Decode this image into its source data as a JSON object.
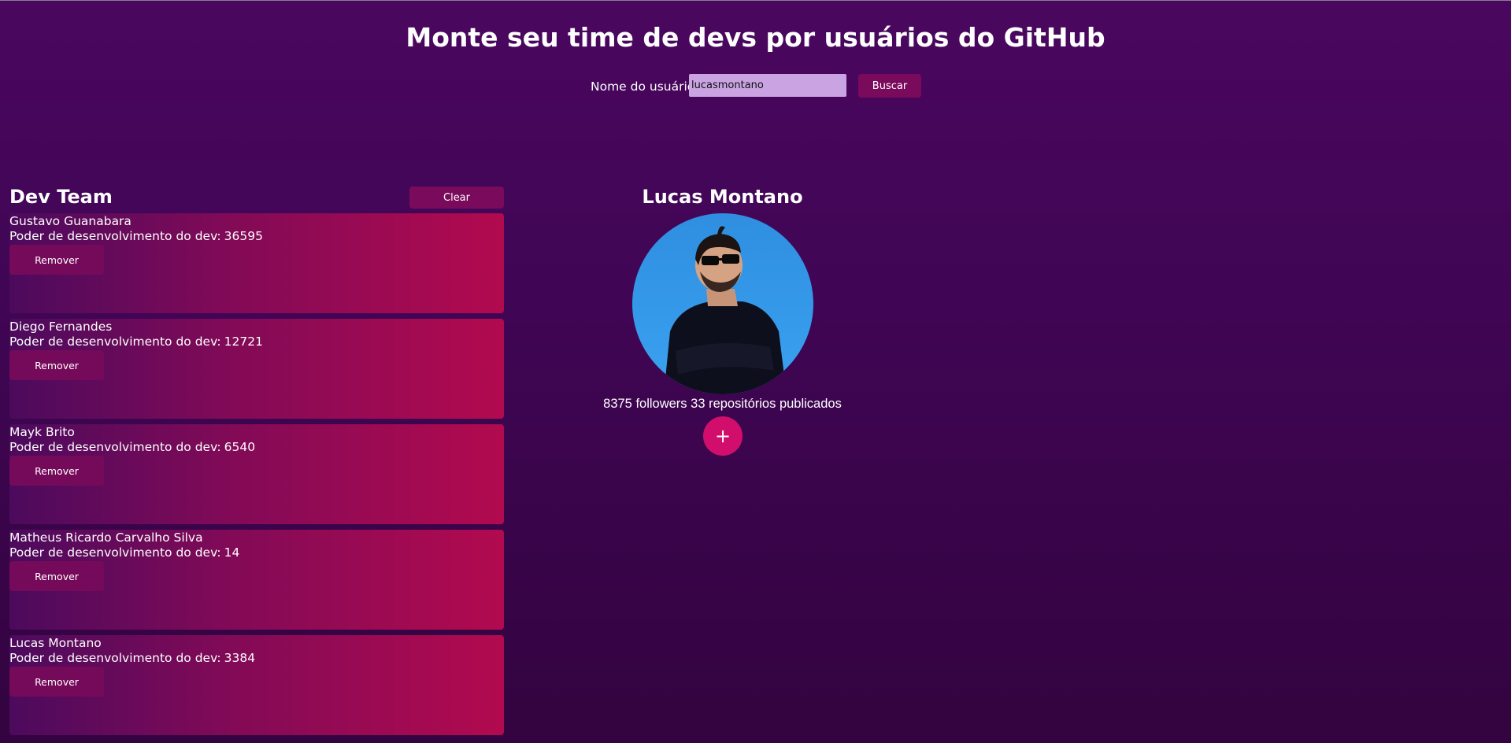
{
  "header": {
    "title": "Monte seu time de devs por usuários do GitHub"
  },
  "search": {
    "label": "Nome do usuário",
    "value": "lucasmontano",
    "button_label": "Buscar"
  },
  "team": {
    "title": "Dev Team",
    "clear_label": "Clear",
    "power_label": "Poder de desenvolvimento do dev:",
    "remove_label": "Remover",
    "members": [
      {
        "name": "Gustavo Guanabara",
        "power": "36595"
      },
      {
        "name": "Diego Fernandes",
        "power": "12721"
      },
      {
        "name": "Mayk Brito",
        "power": "6540"
      },
      {
        "name": "Matheus Ricardo Carvalho Silva",
        "power": "14"
      },
      {
        "name": "Lucas Montano",
        "power": "3384"
      }
    ]
  },
  "profile": {
    "name": "Lucas Montano",
    "stats": "8375 followers 33 repositórios publicados",
    "add_label": "+"
  },
  "colors": {
    "background": "#420559",
    "button": "#7a0a5c",
    "card_gradient_end": "#b20a4f",
    "add_button": "#d10e6b",
    "input_background": "#caa3e2"
  }
}
